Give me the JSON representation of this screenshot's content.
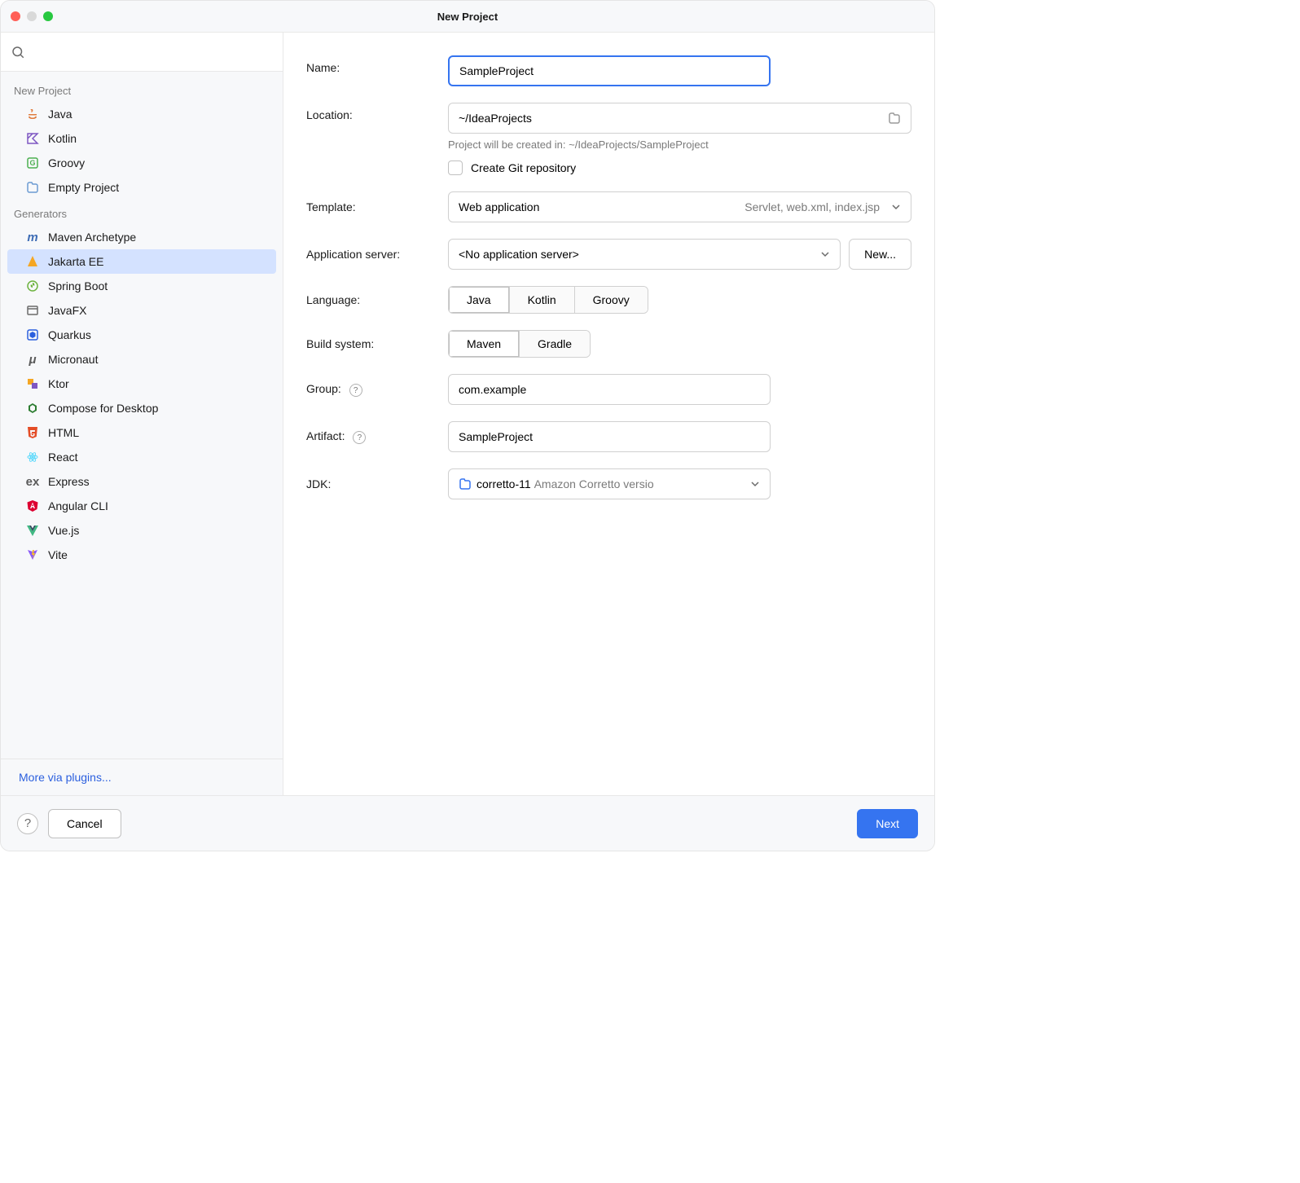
{
  "window": {
    "title": "New Project"
  },
  "sidebar": {
    "search_placeholder": "",
    "section_new_project": "New Project",
    "section_generators": "Generators",
    "new_project_items": [
      {
        "label": "Java"
      },
      {
        "label": "Kotlin"
      },
      {
        "label": "Groovy"
      },
      {
        "label": "Empty Project"
      }
    ],
    "generator_items": [
      {
        "label": "Maven Archetype"
      },
      {
        "label": "Jakarta EE"
      },
      {
        "label": "Spring Boot"
      },
      {
        "label": "JavaFX"
      },
      {
        "label": "Quarkus"
      },
      {
        "label": "Micronaut"
      },
      {
        "label": "Ktor"
      },
      {
        "label": "Compose for Desktop"
      },
      {
        "label": "HTML"
      },
      {
        "label": "React"
      },
      {
        "label": "Express"
      },
      {
        "label": "Angular CLI"
      },
      {
        "label": "Vue.js"
      },
      {
        "label": "Vite"
      }
    ],
    "more_plugins": "More via plugins..."
  },
  "form": {
    "name_label": "Name:",
    "name_value": "SampleProject",
    "location_label": "Location:",
    "location_value": "~/IdeaProjects",
    "location_hint": "Project will be created in: ~/IdeaProjects/SampleProject",
    "git_label": "Create Git repository",
    "template_label": "Template:",
    "template_value": "Web application",
    "template_secondary": "Servlet, web.xml, index.jsp",
    "appserver_label": "Application server:",
    "appserver_value": "<No application server>",
    "appserver_new": "New...",
    "language_label": "Language:",
    "language_options": [
      "Java",
      "Kotlin",
      "Groovy"
    ],
    "buildsystem_label": "Build system:",
    "buildsystem_options": [
      "Maven",
      "Gradle"
    ],
    "group_label": "Group:",
    "group_value": "com.example",
    "artifact_label": "Artifact:",
    "artifact_value": "SampleProject",
    "jdk_label": "JDK:",
    "jdk_name": "corretto-11",
    "jdk_desc": "Amazon Corretto versio"
  },
  "footer": {
    "cancel": "Cancel",
    "next": "Next"
  }
}
